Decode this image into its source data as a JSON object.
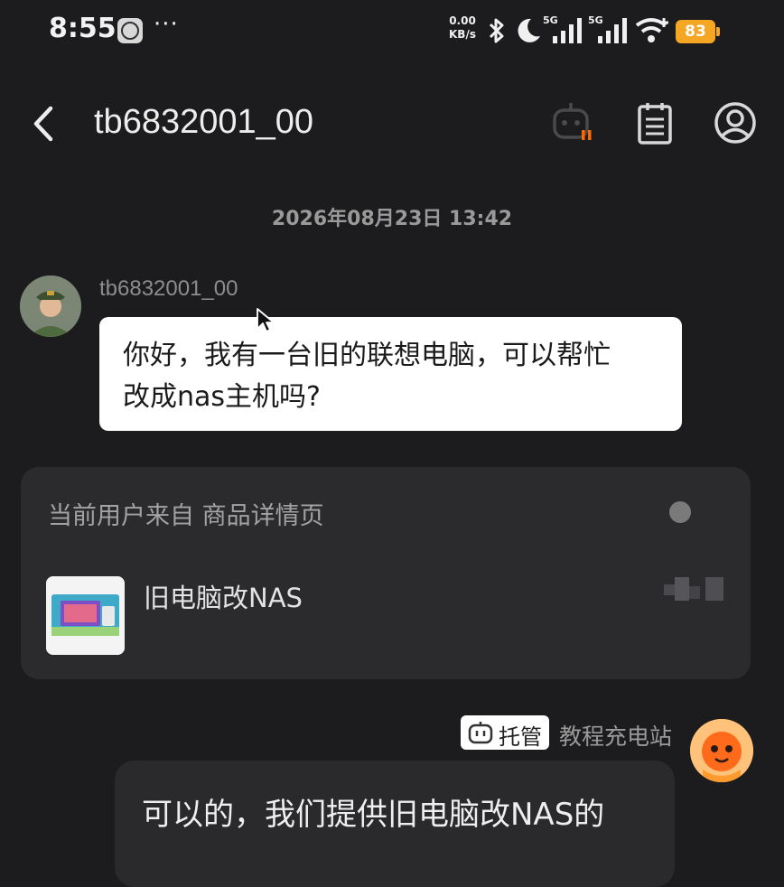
{
  "status_bar": {
    "time": "8:55",
    "more": "···",
    "net_speed_value": "0.00",
    "net_speed_unit": "KB/s",
    "network_1": "5G",
    "network_2": "5G",
    "battery": "83",
    "icons": [
      "clock-app-icon",
      "bluetooth-icon",
      "moon-icon",
      "signal-icon",
      "wifi-icon",
      "battery-icon"
    ]
  },
  "header": {
    "title": "tb6832001_00",
    "icons": [
      "back-icon",
      "robot-icon",
      "notepad-icon",
      "user-icon"
    ]
  },
  "date_label": "2026年08月23日 13:42",
  "incoming": {
    "sender": "tb6832001_00",
    "text_line1": "你好，我有一台旧的联想电脑，可以帮忙",
    "text_line2": "改成nas主机吗?"
  },
  "source_card": {
    "label": "当前用户来自 商品详情页",
    "product_name": "旧电脑改NAS"
  },
  "outgoing": {
    "badge": "托管",
    "agent_name": "教程充电站",
    "text": "可以的，我们提供旧电脑改NAS的"
  },
  "colors": {
    "background": "#1c1c1e",
    "card": "#2b2b2e",
    "battery": "#f5a623",
    "robot_status": "#ff6a00",
    "agent_avatar": "#ff8a1e"
  }
}
